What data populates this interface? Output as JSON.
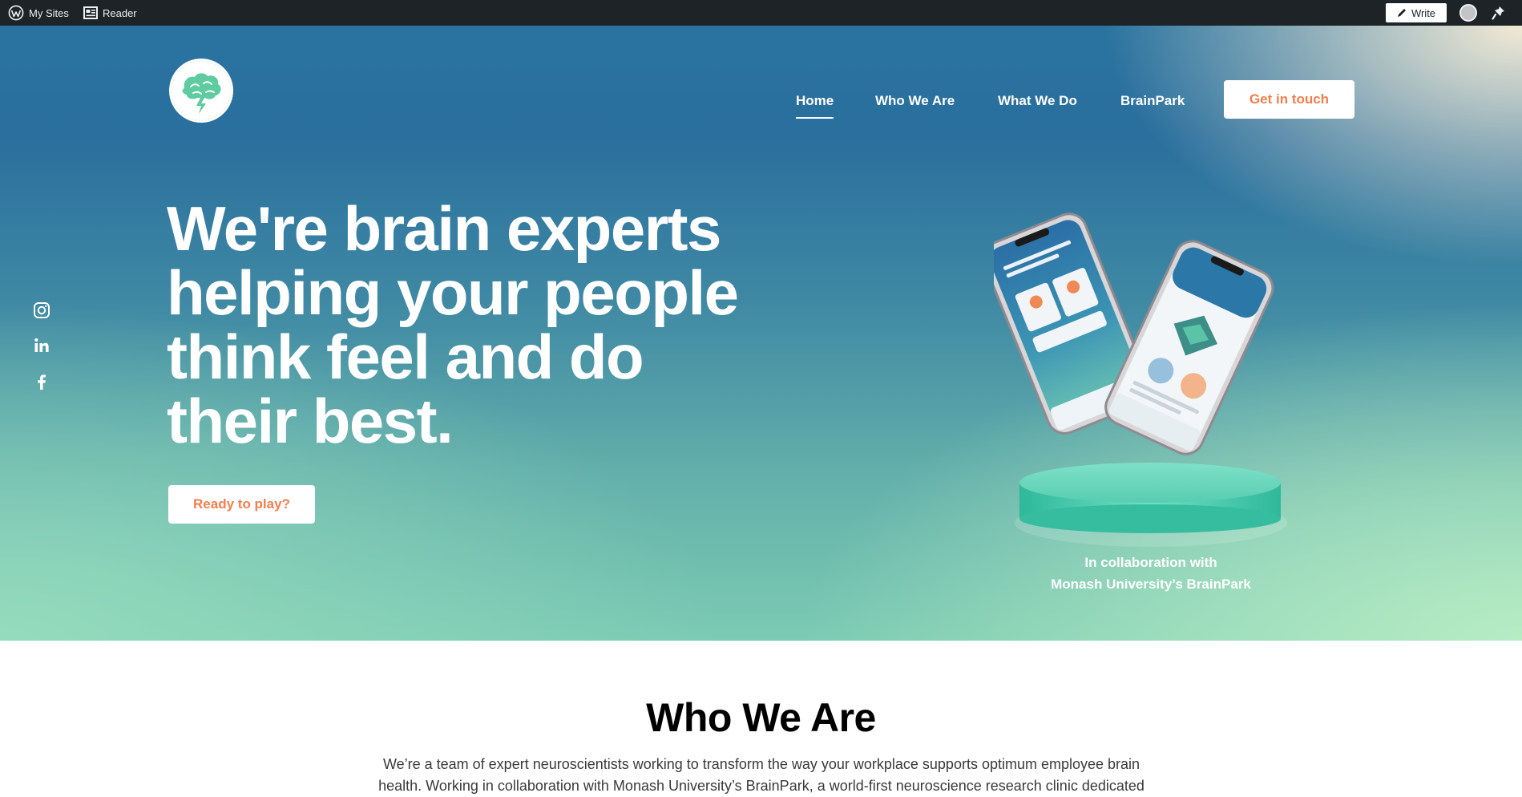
{
  "adminbar": {
    "my_sites": "My Sites",
    "reader": "Reader",
    "write": "Write"
  },
  "nav": {
    "home": "Home",
    "who_we_are": "Who We Are",
    "what_we_do": "What We Do",
    "brainpark": "BrainPark",
    "cta": "Get in touch",
    "active": "Home"
  },
  "hero": {
    "headline_lines": [
      "We're brain experts",
      "helping your people",
      "think feel and do",
      "their best."
    ],
    "cta": "Ready to play?",
    "collab_line1": "In collaboration with",
    "collab_line2": "Monash University’s BrainPark"
  },
  "social": [
    "instagram-icon",
    "linkedin-icon",
    "facebook-icon"
  ],
  "who_we_are": {
    "title": "Who We Are",
    "body": "We’re a team of expert neuroscientists working to transform the way your workplace supports optimum employee brain health. Working in collaboration with Monash University’s BrainPark, a world-first neuroscience research clinic dedicated"
  },
  "colors": {
    "accent": "#f47d4e",
    "adminbar": "#1d2327",
    "hero_top": "#2a73a0",
    "hero_bottom": "#7ccbb3",
    "logo_mint": "#5ecba1"
  }
}
